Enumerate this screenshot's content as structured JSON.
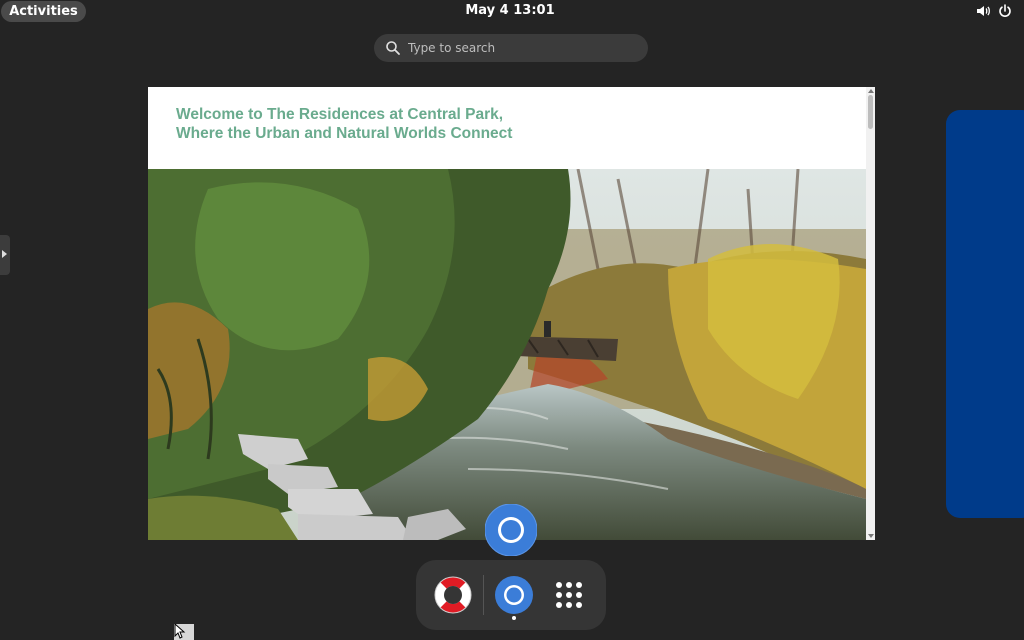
{
  "topbar": {
    "activities_label": "Activities",
    "clock": "May 4  13:01",
    "tray_icons": [
      "volume-icon",
      "power-icon"
    ]
  },
  "search": {
    "placeholder": "Type to search",
    "value": ""
  },
  "window": {
    "app": "Chromium",
    "page": {
      "heading_line1": "Welcome to The Residences at Central Park,",
      "heading_line2": "Where the Urban and Natural Worlds Connect",
      "heading_color": "#6aab8e",
      "photo": "autumn-creek-footbridge-photo"
    }
  },
  "dock": {
    "items": [
      {
        "name": "help",
        "icon": "lifebuoy-icon"
      },
      {
        "name": "chromium",
        "icon": "chromium-icon",
        "running": true
      },
      {
        "name": "show-apps",
        "icon": "app-grid-icon"
      }
    ]
  },
  "colors": {
    "background": "#242424",
    "workspace_accent": "#003b8a",
    "chromium_blue": "#3b7dd8"
  }
}
